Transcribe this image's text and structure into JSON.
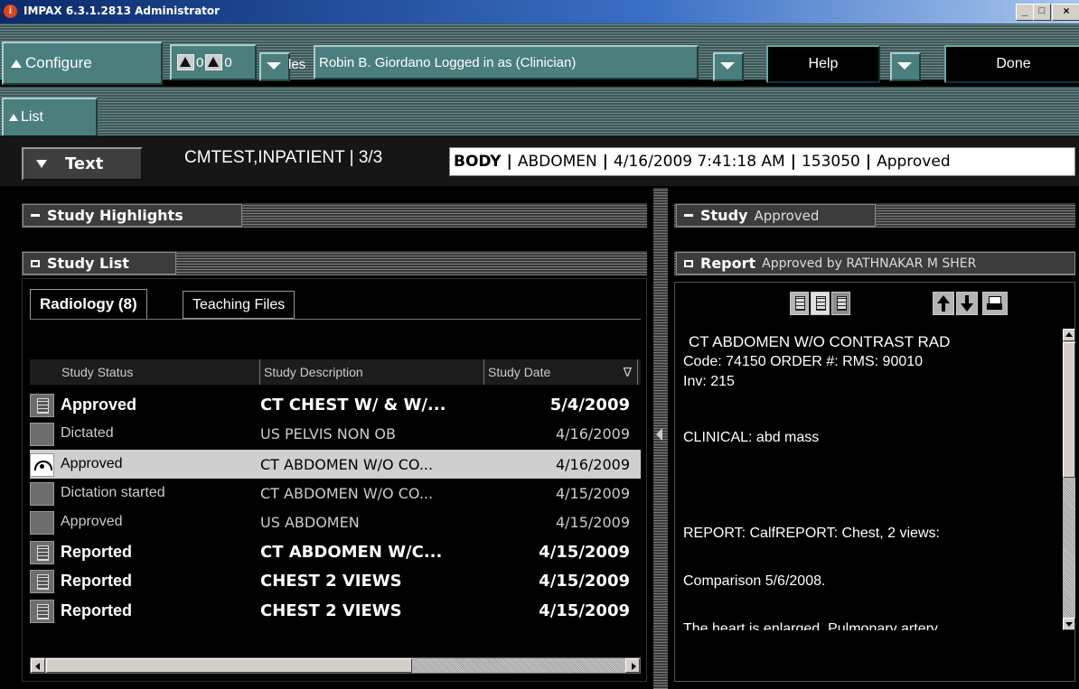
{
  "window": {
    "title": "IMPAX 6.3.1.2813 Administrator",
    "min": "_",
    "max": "□",
    "close": "×"
  },
  "toolbar": {
    "configure": "Configure",
    "alert_count_a": "0",
    "alert_count_b": "0",
    "les_fragment": "les",
    "login_text": "Robin  B. Giordano Logged in as (Clinician)",
    "help": "Help",
    "done": "Done",
    "list": "List"
  },
  "context": {
    "text_button": "Text",
    "patient": "CMTEST,INPATIENT  | 3/3",
    "body_part_label": "BODY",
    "sep": "|",
    "region": "ABDOMEN",
    "datetime": "4/16/2009 7:41:18 AM",
    "accession": "153050",
    "status": "Approved"
  },
  "left": {
    "highlights_title": "Study Highlights",
    "studylist_title": "Study List",
    "tabs": [
      "Radiology (8)",
      "Teaching Files"
    ],
    "columns": [
      "Study Status",
      "Study Description",
      "Study Date"
    ],
    "sort_indicator": "∇",
    "rows": [
      {
        "status": "Approved",
        "desc": "CT CHEST W/ & W/...",
        "date": "5/4/2009"
      },
      {
        "status": "Dictated",
        "desc": "US PELVIS NON OB",
        "date": "4/16/2009"
      },
      {
        "status": "Approved",
        "desc": "CT ABDOMEN W/O CO...",
        "date": "4/16/2009"
      },
      {
        "status": "Dictation started",
        "desc": "CT ABDOMEN W/O CO...",
        "date": "4/15/2009"
      },
      {
        "status": "Approved",
        "desc": "US ABDOMEN",
        "date": "4/15/2009"
      },
      {
        "status": "Reported",
        "desc": "CT ABDOMEN W/C...",
        "date": "4/15/2009"
      },
      {
        "status": "Reported",
        "desc": "CHEST 2 VIEWS",
        "date": "4/15/2009"
      },
      {
        "status": "Reported",
        "desc": "CHEST 2 VIEWS",
        "date": "4/15/2009"
      }
    ]
  },
  "right": {
    "study_title": "Study",
    "study_sub": "Approved",
    "report_title": "Report",
    "report_sub": "Approved by RATHNAKAR M SHER",
    "lines": [
      "CT ABDOMEN W/O CONTRAST    RAD",
      "Code: 74150     ORDER #: RMS: 90010",
      "Inv: 215",
      "CLINICAL: abd mass",
      "REPORT:  CalfREPORT:  Chest, 2 views:",
      "Comparison 5/6/2008.",
      "The heart is enlarged. Pulmonary artery"
    ]
  }
}
